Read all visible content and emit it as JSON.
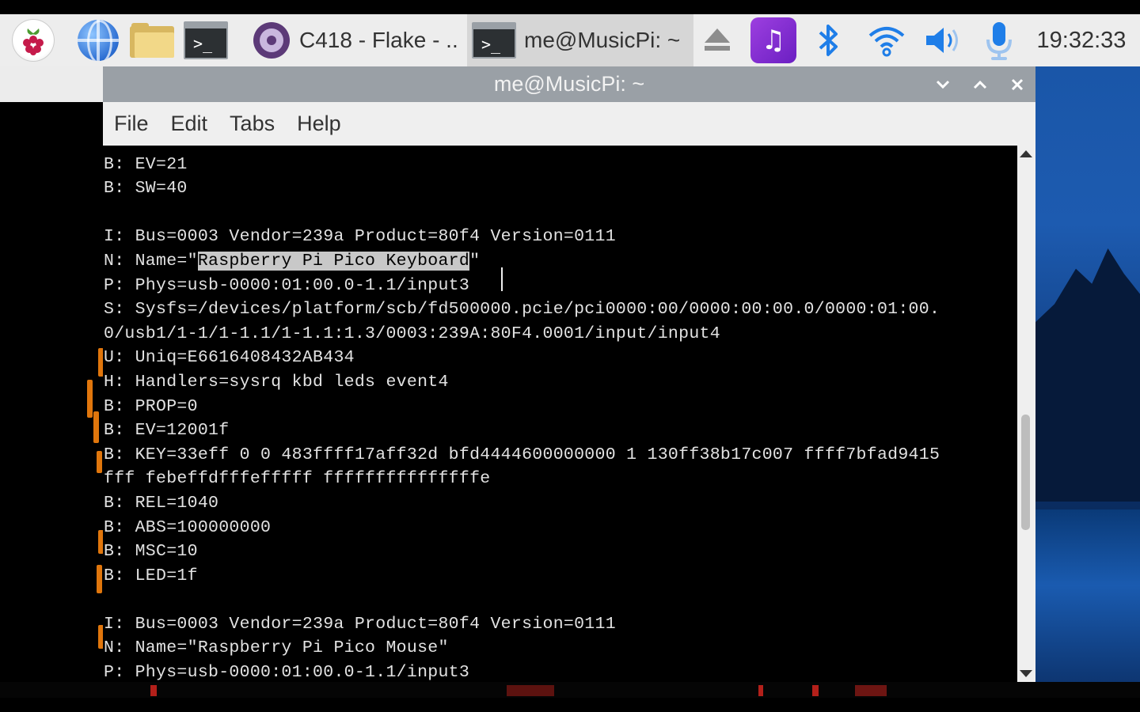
{
  "taskbar": {
    "icons": [
      "raspberry-pi-menu-icon",
      "web-browser-icon",
      "file-manager-icon",
      "terminal-launcher-icon"
    ],
    "tasks": [
      {
        "label": "C418 - Flake - ..",
        "icon": "music-player-icon"
      },
      {
        "label": "me@MusicPi: ~",
        "icon": "terminal-icon",
        "active": true
      }
    ],
    "tray": [
      "eject-icon",
      "music-app-icon",
      "bluetooth-icon",
      "wifi-icon",
      "volume-icon",
      "microphone-icon"
    ],
    "clock": "19:32:33"
  },
  "window": {
    "title": "me@MusicPi: ~",
    "menu": [
      "File",
      "Edit",
      "Tabs",
      "Help"
    ]
  },
  "terminal": {
    "lines": [
      "B: PROP=0",
      "B: EV=21",
      "B: SW=40",
      "",
      "I: Bus=0003 Vendor=239a Product=80f4 Version=0111",
      "N: Name=\"Raspberry Pi Pico Keyboard\"",
      "P: Phys=usb-0000:01:00.0-1.1/input3",
      "S: Sysfs=/devices/platform/scb/fd500000.pcie/pci0000:00/0000:00:00.0/0000:01:00.",
      "0/usb1/1-1/1-1.1/1-1.1:1.3/0003:239A:80F4.0001/input/input4",
      "U: Uniq=E6616408432AB434",
      "H: Handlers=sysrq kbd leds event4",
      "B: PROP=0",
      "B: EV=12001f",
      "B: KEY=33eff 0 0 483ffff17aff32d bfd4444600000000 1 130ff38b17c007 ffff7bfad9415",
      "fff febeffdfffefffff fffffffffffffffe",
      "B: REL=1040",
      "B: ABS=100000000",
      "B: MSC=10",
      "B: LED=1f",
      "",
      "I: Bus=0003 Vendor=239a Product=80f4 Version=0111",
      "N: Name=\"Raspberry Pi Pico Mouse\"",
      "P: Phys=usb-0000:01:00.0-1.1/input3"
    ],
    "selected_text": "Raspberry Pi Pico Keyboard"
  }
}
